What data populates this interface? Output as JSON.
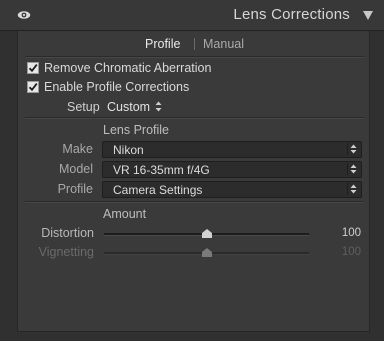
{
  "header": {
    "title": "Lens Corrections",
    "visibility_icon": "eye-icon",
    "collapse_icon": "triangle-down-icon"
  },
  "tabs": [
    {
      "label": "Profile",
      "active": true
    },
    {
      "label": "Manual",
      "active": false
    }
  ],
  "checkboxes": [
    {
      "label": "Remove Chromatic Aberration",
      "checked": true
    },
    {
      "label": "Enable Profile Corrections",
      "checked": true
    }
  ],
  "setup": {
    "label": "Setup",
    "value": "Custom"
  },
  "lens_profile": {
    "title": "Lens Profile",
    "fields": [
      {
        "label": "Make",
        "value": "Nikon"
      },
      {
        "label": "Model",
        "value": "VR 16-35mm f/4G"
      },
      {
        "label": "Profile",
        "value": "Camera Settings"
      }
    ]
  },
  "amount": {
    "title": "Amount",
    "sliders": [
      {
        "label": "Distortion",
        "value": "100",
        "enabled": true,
        "level": 0.5
      },
      {
        "label": "Vignetting",
        "value": "100",
        "enabled": false,
        "level": 0.5
      }
    ]
  },
  "colors": {
    "panel_bg": "#3a3a3a",
    "header_bg": "#383838",
    "text": "#d9d9d9",
    "disabled_text": "#6a6a6a"
  }
}
